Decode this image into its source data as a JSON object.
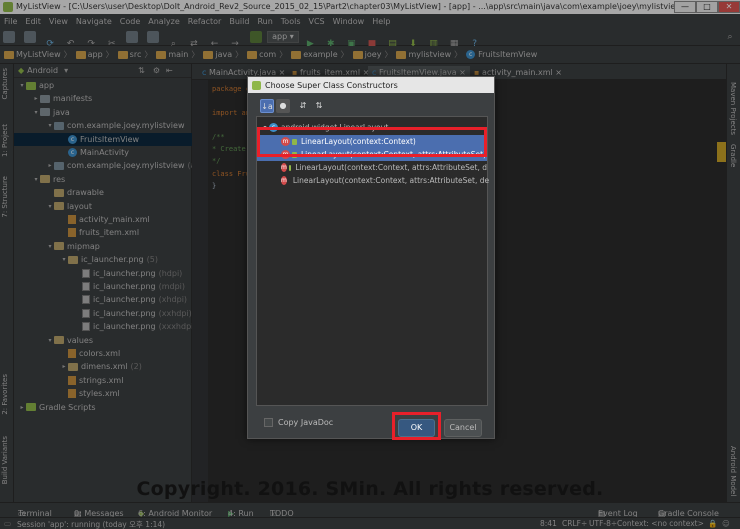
{
  "window": {
    "title": "MyListView - [C:\\Users\\user\\Desktop\\DoIt_Android_Rev2_Source_2015_02_15\\Part2\\chapter03\\MyListView] - [app] - ...\\app\\src\\main\\java\\com\\example\\joey\\mylistview\\FruitsI..."
  },
  "menu": [
    "File",
    "Edit",
    "View",
    "Navigate",
    "Code",
    "Analyze",
    "Refactor",
    "Build",
    "Run",
    "Tools",
    "VCS",
    "Window",
    "Help"
  ],
  "toolbar": {
    "run_config": "app"
  },
  "breadcrumb": [
    "MyListView",
    "app",
    "src",
    "main",
    "java",
    "com",
    "example",
    "joey",
    "mylistview",
    "FruitsItemView"
  ],
  "project_panel": {
    "view_selector": "Android",
    "tree": [
      {
        "label": "app",
        "icon": "module"
      },
      {
        "label": "manifests",
        "icon": "folder"
      },
      {
        "label": "java",
        "icon": "folder"
      },
      {
        "label": "com.example.joey.mylistview",
        "icon": "package"
      },
      {
        "label": "FruitsItemView",
        "icon": "class",
        "selected": true
      },
      {
        "label": "MainActivity",
        "icon": "class"
      },
      {
        "label": "com.example.joey.mylistview",
        "icon": "package",
        "suffix": "(andro"
      },
      {
        "label": "res",
        "icon": "res-folder"
      },
      {
        "label": "drawable",
        "icon": "res-folder"
      },
      {
        "label": "layout",
        "icon": "res-folder"
      },
      {
        "label": "activity_main.xml",
        "icon": "xml"
      },
      {
        "label": "fruits_item.xml",
        "icon": "xml"
      },
      {
        "label": "mipmap",
        "icon": "res-folder"
      },
      {
        "label": "ic_launcher.png",
        "icon": "res-folder",
        "suffix": "(5)"
      },
      {
        "label": "ic_launcher.png",
        "icon": "png",
        "suffix": "(hdpi)"
      },
      {
        "label": "ic_launcher.png",
        "icon": "png",
        "suffix": "(mdpi)"
      },
      {
        "label": "ic_launcher.png",
        "icon": "png",
        "suffix": "(xhdpi)"
      },
      {
        "label": "ic_launcher.png",
        "icon": "png",
        "suffix": "(xxhdpi)"
      },
      {
        "label": "ic_launcher.png",
        "icon": "png",
        "suffix": "(xxxhdpi)"
      },
      {
        "label": "values",
        "icon": "res-folder"
      },
      {
        "label": "colors.xml",
        "icon": "xml"
      },
      {
        "label": "dimens.xml",
        "icon": "res-folder",
        "suffix": "(2)"
      },
      {
        "label": "strings.xml",
        "icon": "xml"
      },
      {
        "label": "styles.xml",
        "icon": "xml"
      },
      {
        "label": "Gradle Scripts",
        "icon": "gradle"
      }
    ]
  },
  "editor_tabs": [
    "MainActivity.java",
    "fruits_item.xml",
    "FruitsItemView.java",
    "activity_main.xml"
  ],
  "editor_code": [
    "package co",
    "import an",
    "/**",
    " * Create",
    " */",
    "class Fru",
    "}"
  ],
  "dialog": {
    "title": "Choose Super Class Constructors",
    "group": "android.widget.LinearLayout",
    "items": [
      {
        "label": "LinearLayout(context:Context)",
        "selected": true
      },
      {
        "label": "LinearLayout(context:Context, attrs:AttributeSet)",
        "selected": true
      },
      {
        "label": "LinearLayout(context:Context, attrs:AttributeSet, d",
        "selected": false
      },
      {
        "label": "LinearLayout(context:Context, attrs:AttributeSet, de",
        "selected": false
      }
    ],
    "copy_javadoc": "Copy JavaDoc",
    "ok": "OK",
    "cancel": "Cancel"
  },
  "left_strip": [
    "Captures",
    "1: Project",
    "7: Structure",
    "2: Favorites",
    "Build Variants"
  ],
  "right_strip": [
    "Maven Projects",
    "Gradle",
    "Android Model"
  ],
  "bottom_tools": {
    "terminal": "Terminal",
    "messages": "0: Messages",
    "monitor": "6: Android Monitor",
    "run": "4: Run",
    "todo": "TODO",
    "event_log": "Event Log",
    "gradle_console": "Gradle Console"
  },
  "status": {
    "message": "Session 'app': running (today 오후 1:14)",
    "position": "8:41",
    "line_sep": "CRLF÷",
    "encoding": "UTF-8÷",
    "context": "Context: <no context>"
  },
  "watermark": "Copyright. 2016. SMin. All rights reserved."
}
